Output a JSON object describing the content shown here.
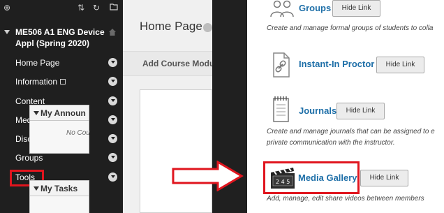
{
  "sidebar": {
    "course_title": "ME506 A1 ENG Device Appl (Spring 2020)",
    "items": [
      {
        "label": "Home Page"
      },
      {
        "label": "Information"
      },
      {
        "label": "Content"
      },
      {
        "label": "Media Gallery"
      },
      {
        "label": "Discussions"
      },
      {
        "label": "Groups"
      },
      {
        "label": "Tools"
      }
    ]
  },
  "main": {
    "page_title": "Home Page",
    "add_module_label": "Add Course Modul",
    "modules": [
      {
        "title": "My Announ",
        "body": "No Cou"
      },
      {
        "title": "My Tasks",
        "body": ""
      }
    ]
  },
  "tools": [
    {
      "name": "Groups",
      "button": "Hide Link",
      "description": "Create and manage formal groups of students to colla",
      "icon": "people-icon"
    },
    {
      "name": "Instant-In Proctor",
      "button": "Hide Link",
      "description": "",
      "icon": "document-link-icon"
    },
    {
      "name": "Journals",
      "button": "Hide Link",
      "description": "Create and manage journals that can be assigned to e",
      "description2": "private communication with the instructor.",
      "icon": "notebook-icon"
    },
    {
      "name": "Media Gallery",
      "button": "Hide Link",
      "description": "Add, manage, edit share videos between members",
      "icon": "clapperboard-icon"
    }
  ],
  "colors": {
    "sidebar_bg": "#1f1f1f",
    "highlight_red": "#e0151e",
    "link_blue": "#1e6fa8"
  }
}
